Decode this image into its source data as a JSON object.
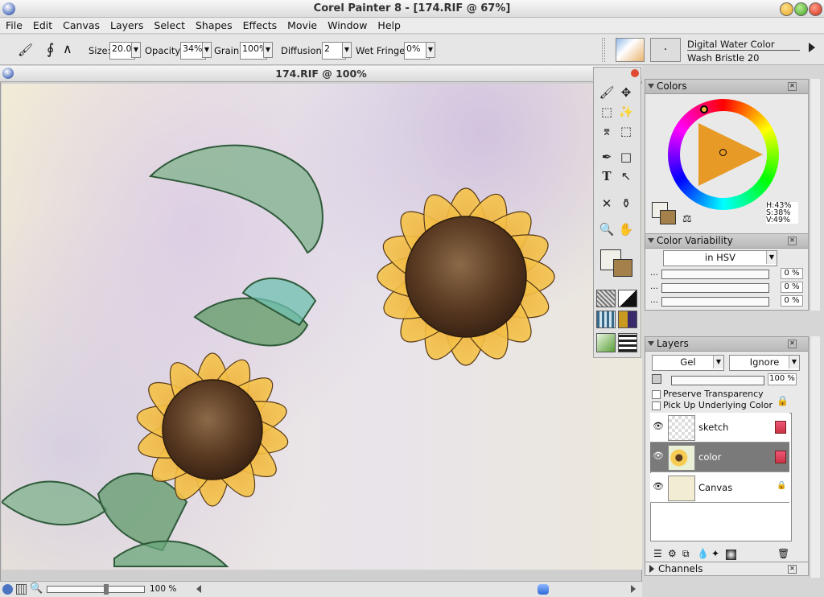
{
  "window": {
    "title": "Corel Painter 8 - [174.RIF @ 67%]"
  },
  "menu": [
    "File",
    "Edit",
    "Canvas",
    "Layers",
    "Select",
    "Shapes",
    "Effects",
    "Movie",
    "Window",
    "Help"
  ],
  "property_bar": {
    "size_label": "Size:",
    "size_value": "20.0",
    "opacity_label": "Opacity:",
    "opacity_value": "34%",
    "grain_label": "Grain:",
    "grain_value": "100%",
    "diffusion_label": "Diffusion:",
    "diffusion_value": "2",
    "wet_fringe_label": "Wet Fringe:",
    "wet_fringe_value": "0%",
    "brush_category": "Digital Water Color",
    "brush_variant": "Wash Bristle 20"
  },
  "document": {
    "title": "174.RIF @ 100%",
    "zoom": "100 %"
  },
  "colors_panel": {
    "title": "Colors",
    "h": "H:43%",
    "s": "S:38%",
    "v": "V:49%",
    "primary_color": "#f0efe8",
    "secondary_color": "#a4804a"
  },
  "color_variability": {
    "title": "Color Variability",
    "mode": "in HSV",
    "values": [
      "0 %",
      "0 %",
      "0 %"
    ]
  },
  "layers_panel": {
    "title": "Layers",
    "composite_method": "Gel",
    "composite_depth": "Ignore",
    "opacity": "100 %",
    "preserve_transparency": "Preserve Transparency",
    "pick_up_underlying": "Pick Up Underlying Color",
    "layers": [
      "sketch",
      "color",
      "Canvas"
    ]
  },
  "channels_panel": {
    "title": "Channels"
  },
  "icons": [
    "paintbrush",
    "lasso",
    "transform",
    "rect-select",
    "magic-wand",
    "crop",
    "pen",
    "text",
    "eyedropper",
    "paint-bucket",
    "magnifier",
    "grabber-hand"
  ]
}
